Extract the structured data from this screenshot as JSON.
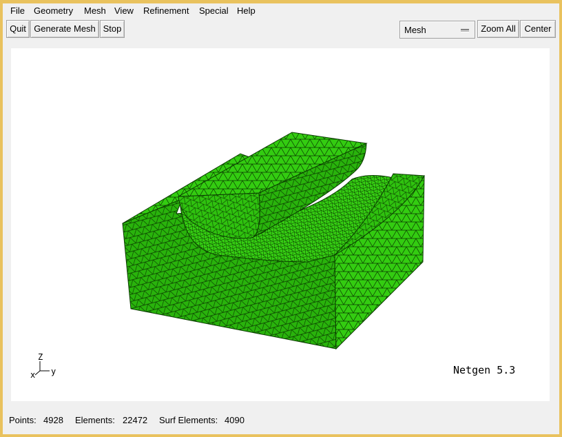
{
  "menubar": {
    "items": [
      "File",
      "Geometry",
      "Mesh",
      "View",
      "Refinement",
      "Special",
      "Help"
    ]
  },
  "toolbar": {
    "quit_label": "Quit",
    "generate_label": "Generate Mesh",
    "stop_label": "Stop",
    "mode_select_value": "Mesh",
    "zoom_all_label": "Zoom All",
    "center_label": "Center"
  },
  "viewport": {
    "axis_z": "Z",
    "axis_x": "x",
    "axis_y": "y",
    "version_text": "Netgen 5.3",
    "mesh_color": "#33cc11",
    "background": "#ffffff"
  },
  "status": {
    "points_label": "Points:",
    "points_value": "4928",
    "elements_label": "Elements:",
    "elements_value": "22472",
    "surf_label": "Surf Elements:",
    "surf_value": "4090"
  }
}
